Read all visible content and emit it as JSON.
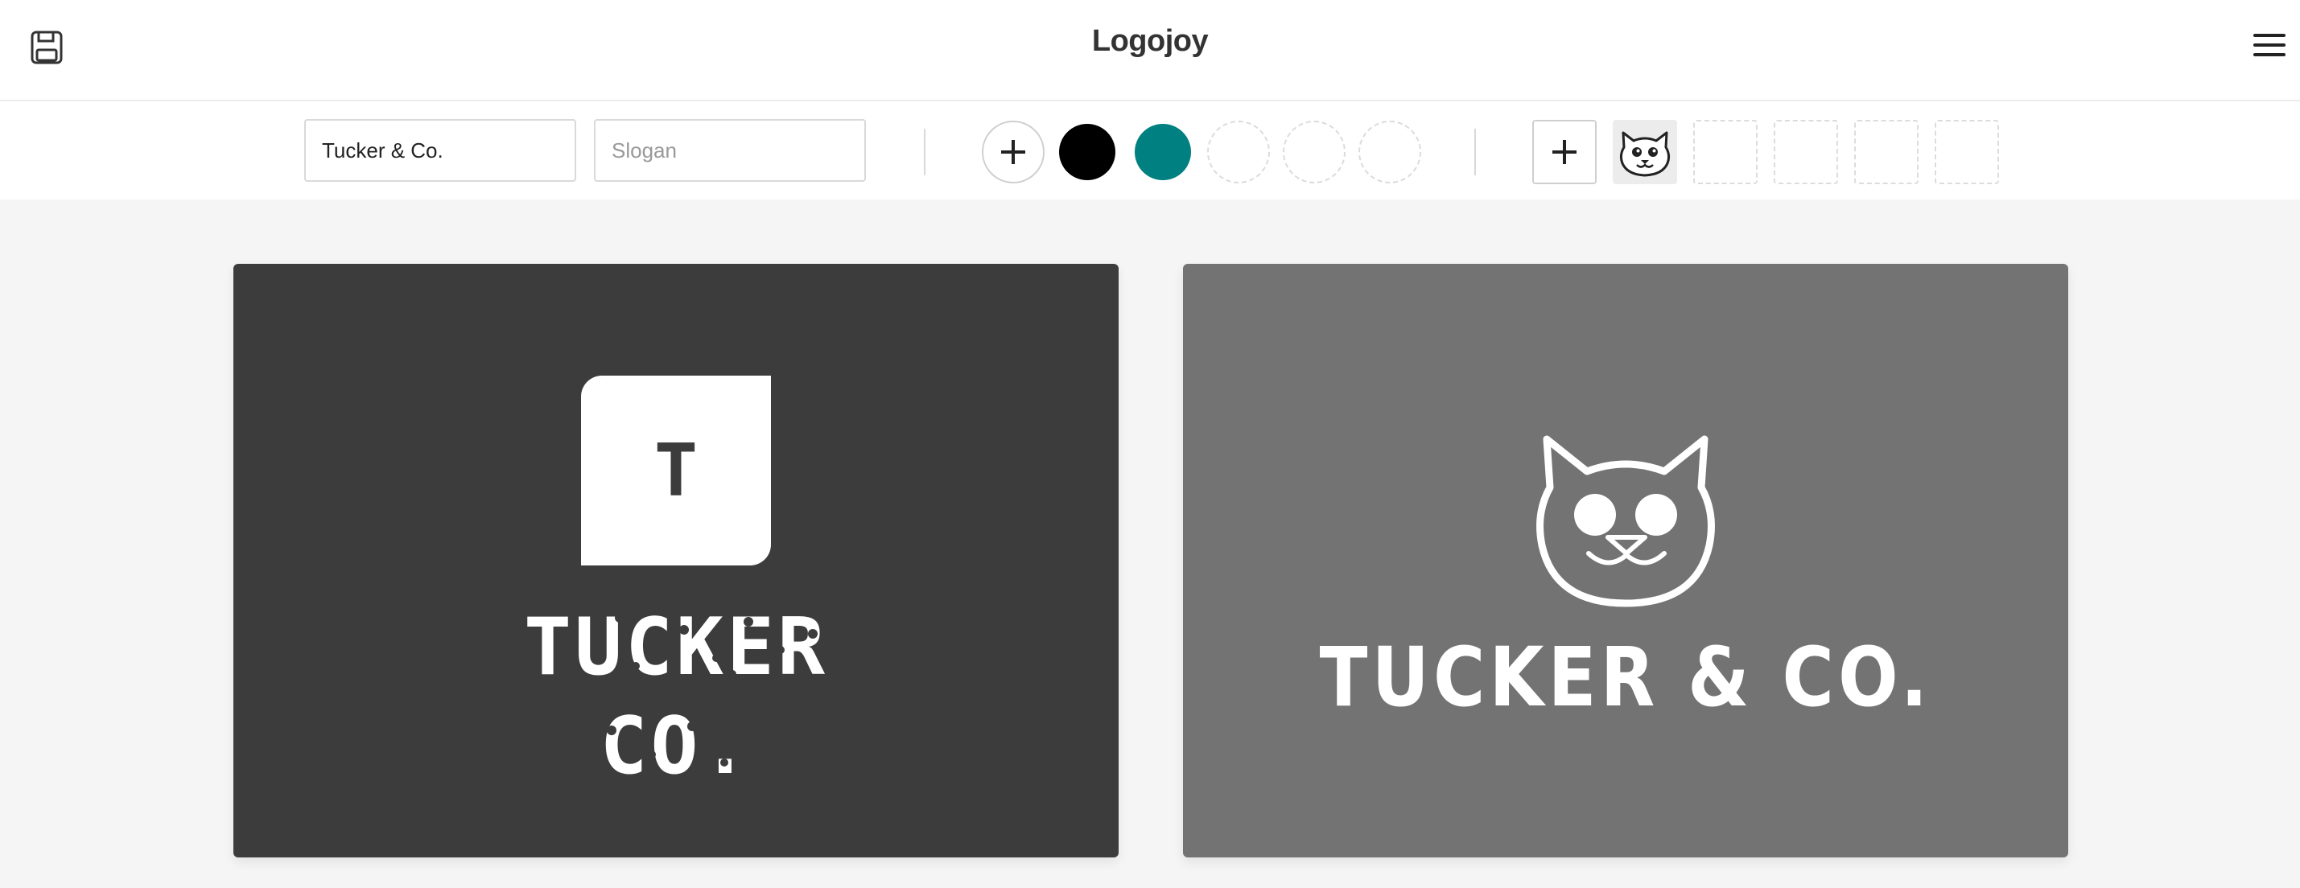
{
  "app": {
    "title": "Logojoy"
  },
  "header": {
    "save_icon": "floppy-disk-icon",
    "menu_icon": "hamburger-menu-icon"
  },
  "toolbar": {
    "company_name": {
      "value": "Tucker & Co.",
      "placeholder": ""
    },
    "slogan": {
      "value": "",
      "placeholder": "Slogan"
    },
    "colors": {
      "add_icon": "plus-icon",
      "swatches": [
        "#000000",
        "#008080"
      ],
      "empty_slots": 3
    },
    "symbols": {
      "add_icon": "plus-icon",
      "selected_icon": "cat-face-icon",
      "empty_slots": 4
    }
  },
  "previews": [
    {
      "background": "#3c3c3c",
      "badge_letter": "T",
      "name_lines": [
        "TUCKER",
        "CO."
      ],
      "style": "dotted"
    },
    {
      "background": "#737373",
      "icon": "cat-face-icon",
      "name": "TUCKER & CO.",
      "style": "hand-drawn"
    }
  ]
}
